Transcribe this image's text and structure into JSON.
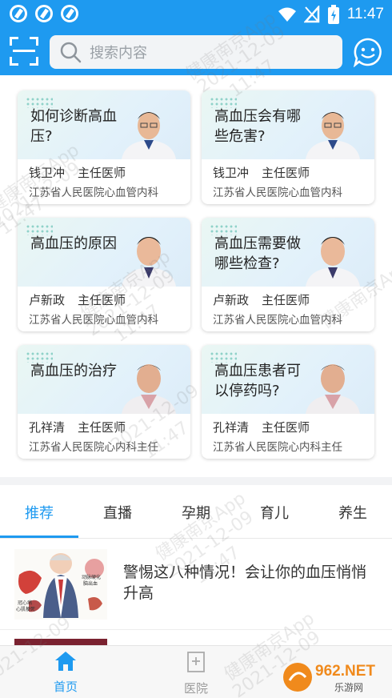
{
  "status_bar": {
    "time": "11:47"
  },
  "search": {
    "placeholder": "搜索内容"
  },
  "cards": [
    {
      "title": "如何诊断高血压?",
      "doctor": "钱卫冲",
      "role": "主任医师",
      "hospital": "江苏省人民医院心血管内科"
    },
    {
      "title": "高血压会有哪些危害?",
      "doctor": "钱卫冲",
      "role": "主任医师",
      "hospital": "江苏省人民医院心血管内科"
    },
    {
      "title": "高血压的原因",
      "doctor": "卢新政",
      "role": "主任医师",
      "hospital": "江苏省人民医院心血管内科"
    },
    {
      "title": "高血压需要做哪些检查?",
      "doctor": "卢新政",
      "role": "主任医师",
      "hospital": "江苏省人民医院心血管内科"
    },
    {
      "title": "高血压的治疗",
      "doctor": "孔祥清",
      "role": "主任医师",
      "hospital": "江苏省人民医院心内科主任"
    },
    {
      "title": "高血压患者可以停药吗?",
      "doctor": "孔祥清",
      "role": "主任医师",
      "hospital": "江苏省人民医院心内科主任"
    }
  ],
  "tabs": [
    "推荐",
    "直播",
    "孕期",
    "育儿",
    "养生"
  ],
  "article": {
    "title": "警惕这八种情况！会让你的血压悄悄升高",
    "image_labels": [
      "动脉硬化",
      "脑出血",
      "冠心病",
      "心肌梗死"
    ]
  },
  "bottom_nav": {
    "home": "首页",
    "hospital": "医院"
  },
  "watermark": {
    "app": "健康南京App",
    "date": "2021-12-09",
    "time": "11:47"
  },
  "brand": {
    "logo": "962.NET",
    "sub": "乐游网"
  },
  "colors": {
    "primary": "#1e9af0"
  }
}
